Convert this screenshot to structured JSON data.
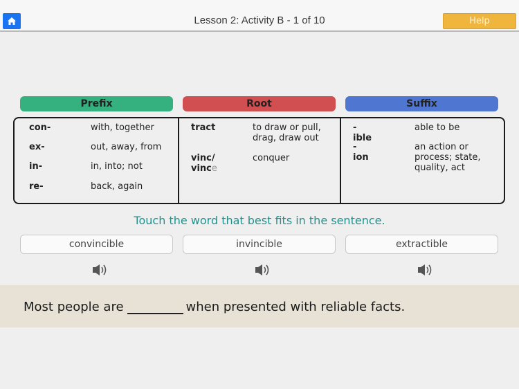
{
  "header": {
    "title": "Lesson 2:  Activity B - 1 of 10",
    "help_label": "Help",
    "home_icon": "home-icon"
  },
  "categories": {
    "prefix": "Prefix",
    "root": "Root",
    "suffix": "Suffix"
  },
  "colors": {
    "prefix": "#35b07f",
    "root": "#d14f50",
    "suffix": "#4f77d1",
    "home": "#1a73f0",
    "help": "#efb53c",
    "instruction": "#22918c"
  },
  "prefixes": [
    {
      "part": "con-",
      "meaning": "with, together"
    },
    {
      "part": "ex-",
      "meaning": "out, away, from"
    },
    {
      "part": "in-",
      "meaning": "in, into; not"
    },
    {
      "part": "re-",
      "meaning": "back, again"
    }
  ],
  "roots": [
    {
      "part": "tract",
      "meaning_line1": "to draw or pull,",
      "meaning_line2": "drag, draw out"
    },
    {
      "part_line1": "vinc/",
      "part_line2_main": "vinc",
      "part_line2_faded": "e",
      "meaning": "conquer"
    }
  ],
  "suffixes": [
    {
      "part": "-ible",
      "meaning": "able to be"
    },
    {
      "part": "-ion",
      "meaning_line1": "an action or",
      "meaning_line2": "process; state,",
      "meaning_line3": "quality, act"
    }
  ],
  "instruction": "Touch the word that best fits in the sentence.",
  "choices": [
    {
      "label": "convincible",
      "audio_icon": "speaker-icon"
    },
    {
      "label": "invincible",
      "audio_icon": "speaker-icon"
    },
    {
      "label": "extractible",
      "audio_icon": "speaker-icon"
    }
  ],
  "sentence": {
    "before": "Most people are",
    "after": "when presented with reliable facts."
  }
}
